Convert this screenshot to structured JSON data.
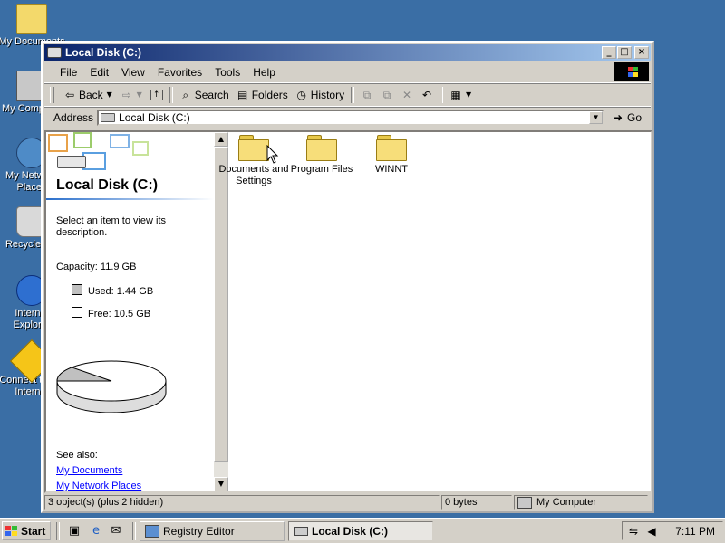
{
  "desktop": {
    "icons": [
      {
        "label": "My Documents",
        "icon": "folder-icon"
      },
      {
        "label": "My Computer",
        "icon": "computer-icon"
      },
      {
        "label": "My Network Places",
        "icon": "network-icon"
      },
      {
        "label": "Recycle Bin",
        "icon": "recycle-bin-icon"
      },
      {
        "label": "Internet Explorer",
        "icon": "internet-explorer-icon"
      },
      {
        "label": "Connect to the Internet",
        "icon": "connect-icon"
      }
    ]
  },
  "window": {
    "title": "Local Disk (C:)",
    "controls": {
      "minimize": "_",
      "maximize": "□",
      "close": "×"
    },
    "menu": [
      "File",
      "Edit",
      "View",
      "Favorites",
      "Tools",
      "Help"
    ],
    "toolbar": {
      "back": "Back",
      "search": "Search",
      "folders": "Folders",
      "history": "History"
    },
    "address": {
      "label": "Address",
      "value": "Local Disk (C:)",
      "go": "Go"
    }
  },
  "left_pane": {
    "title": "Local Disk (C:)",
    "description": "Select an item to view its description.",
    "capacity": "Capacity: 11.9 GB",
    "used": "Used: 1.44 GB",
    "free": "Free: 10.5 GB",
    "used_fraction": 0.12,
    "see_also": "See also:",
    "links": [
      "My Documents",
      "My Network Places"
    ]
  },
  "files": [
    {
      "name": "Documents and Settings"
    },
    {
      "name": "Program Files"
    },
    {
      "name": "WINNT"
    }
  ],
  "status": {
    "objects": "3 object(s) (plus 2 hidden)",
    "size": "0 bytes",
    "zone": "My Computer"
  },
  "taskbar": {
    "start": "Start",
    "tasks": [
      {
        "label": "Registry Editor",
        "active": false
      },
      {
        "label": "Local Disk (C:)",
        "active": true
      }
    ],
    "clock": "7:11 PM"
  },
  "colors": {
    "desktop": "#3a6ea5",
    "titlebar_start": "#0a246a",
    "titlebar_end": "#a6caf0",
    "chrome": "#d4d0c8"
  }
}
